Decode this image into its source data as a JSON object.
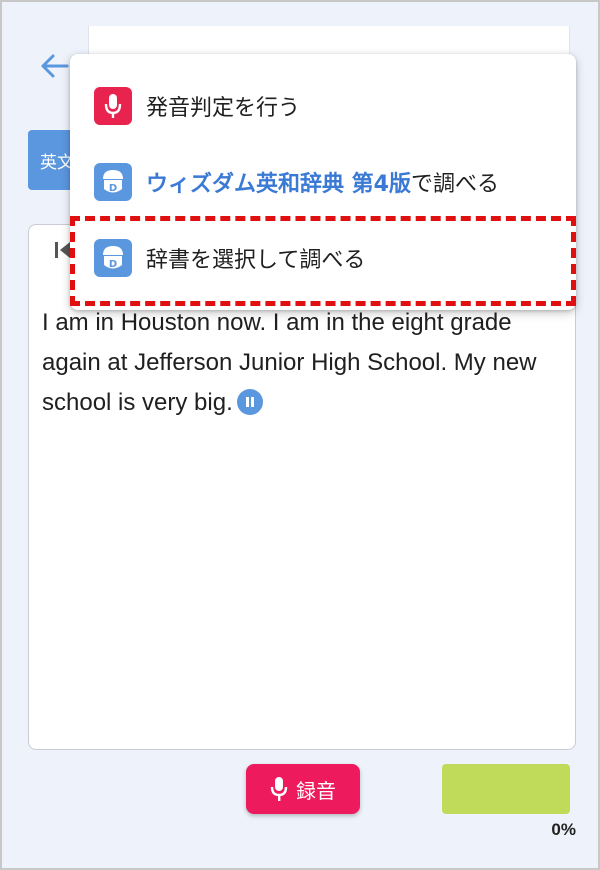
{
  "tab": {
    "label": "英文"
  },
  "passage": {
    "text": "I am in Houston now. I am in the eight grade again at Jefferson Junior High School. My new school is very big."
  },
  "record_button": {
    "label": "録音"
  },
  "score": {
    "value": 0,
    "text": "0%"
  },
  "menu": {
    "items": [
      {
        "label": "発音判定を行う",
        "icon": "microphone-icon"
      },
      {
        "dict_name": "ウィズダム英和辞典 第4版",
        "suffix": "で調べる",
        "icon": "dictionary-icon"
      },
      {
        "label": "辞書を選択して調べる",
        "icon": "dictionary-icon"
      }
    ]
  },
  "colors": {
    "accent_blue": "#5b97df",
    "record_pink": "#ee1a5e",
    "mic_red": "#e8244e",
    "score_green": "#c0da5a",
    "highlight_red": "#e01010"
  }
}
